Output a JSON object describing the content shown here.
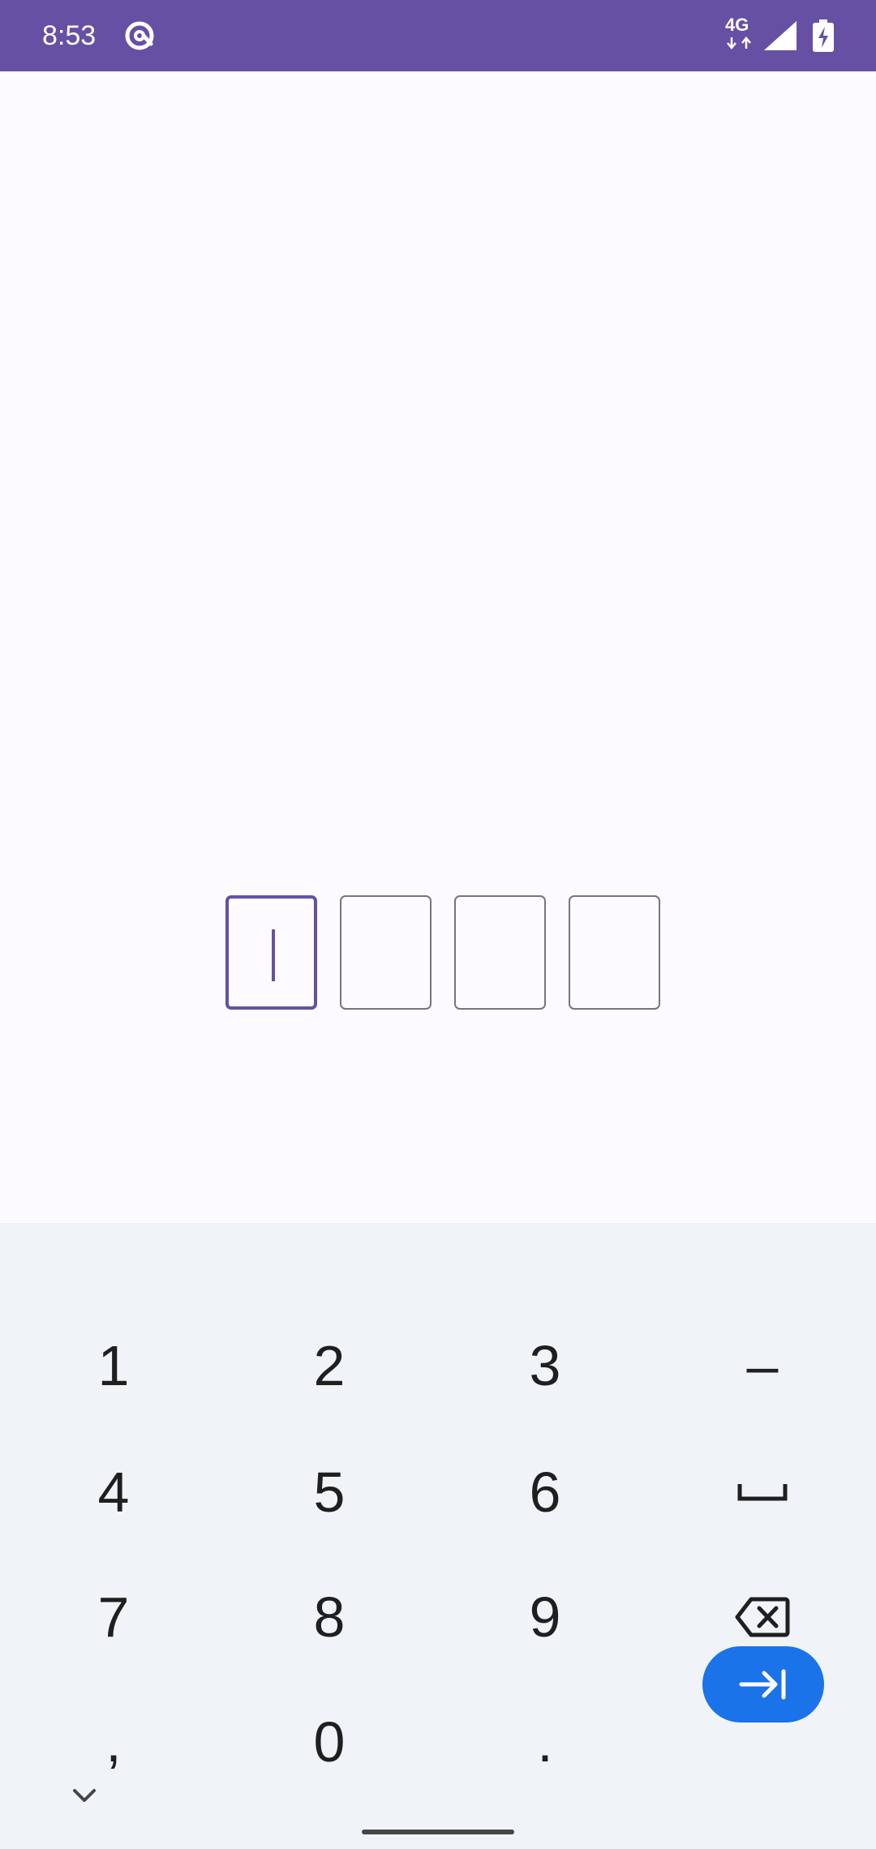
{
  "status_bar": {
    "time": "8:53",
    "network": "4G",
    "app_icon": "at-sign-icon",
    "signal_icon": "cell-signal-icon",
    "battery_icon": "battery-charging-icon",
    "background_color": "#6650a4"
  },
  "otp": {
    "digits": [
      "",
      "",
      "",
      ""
    ],
    "focused_index": 0,
    "accent_color": "#6650a4"
  },
  "keyboard": {
    "rows": [
      [
        "1",
        "2",
        "3",
        "–"
      ],
      [
        "4",
        "5",
        "6",
        "space-icon"
      ],
      [
        "7",
        "8",
        "9",
        "backspace-icon"
      ],
      [
        ",",
        "0",
        ".",
        "next-icon"
      ]
    ],
    "enter_color": "#1a73e8",
    "collapse_icon": "chevron-down-icon"
  }
}
